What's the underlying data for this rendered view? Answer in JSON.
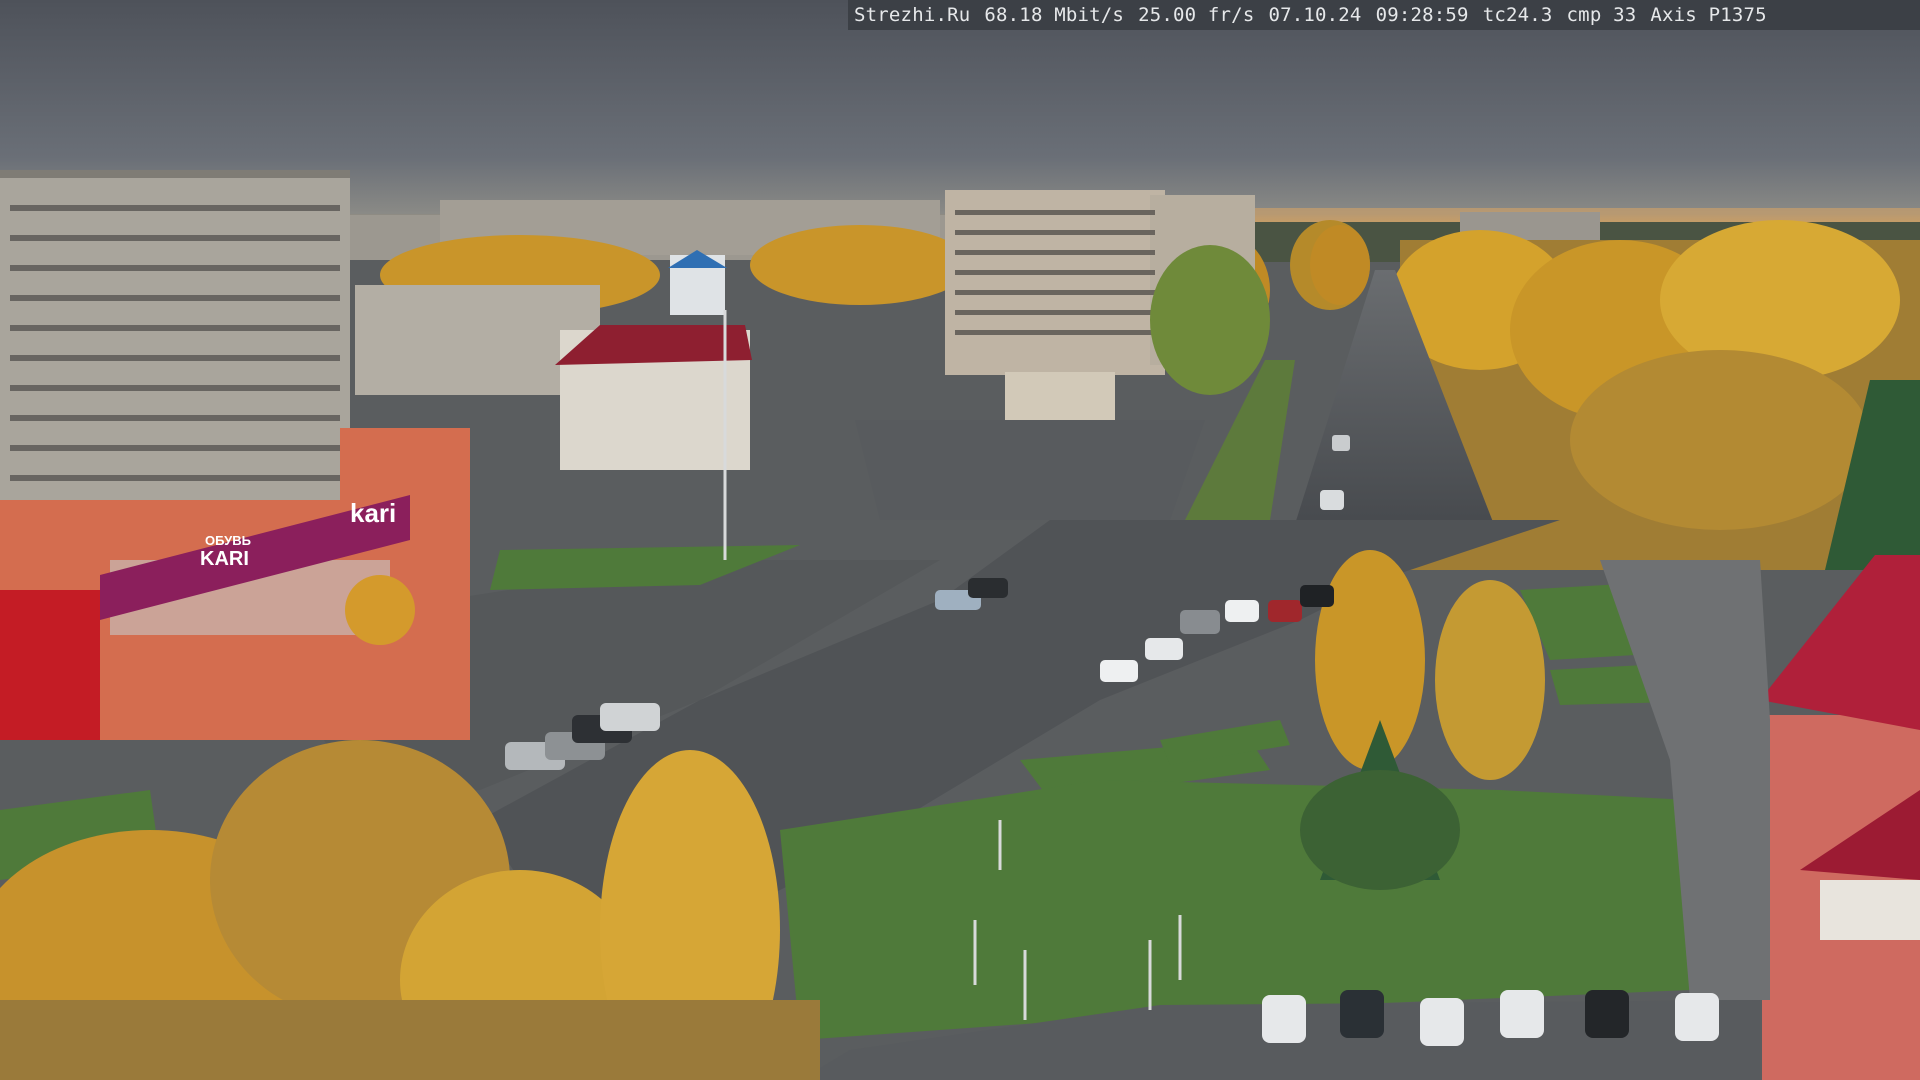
{
  "overlay": {
    "site": "Strezhi.Ru",
    "bitrate": "68.18 Mbit/s",
    "framerate": "25.00 fr/s",
    "date": "07.10.24",
    "time": "09:28:59",
    "tc": "tc24.3",
    "cmp": "cmp 33",
    "camera": "Axis P1375"
  },
  "signs": {
    "store_brand": "kari",
    "store_banner_lower": "KARI",
    "store_banner_upper": "ОБУВЬ"
  },
  "colors": {
    "sky": "#5f646b",
    "foliage": "#c9952a",
    "road": "#4b4e52",
    "grass": "#4f7a3a",
    "store_sign": "#8b1f5c",
    "roof_red": "#b0203a"
  }
}
